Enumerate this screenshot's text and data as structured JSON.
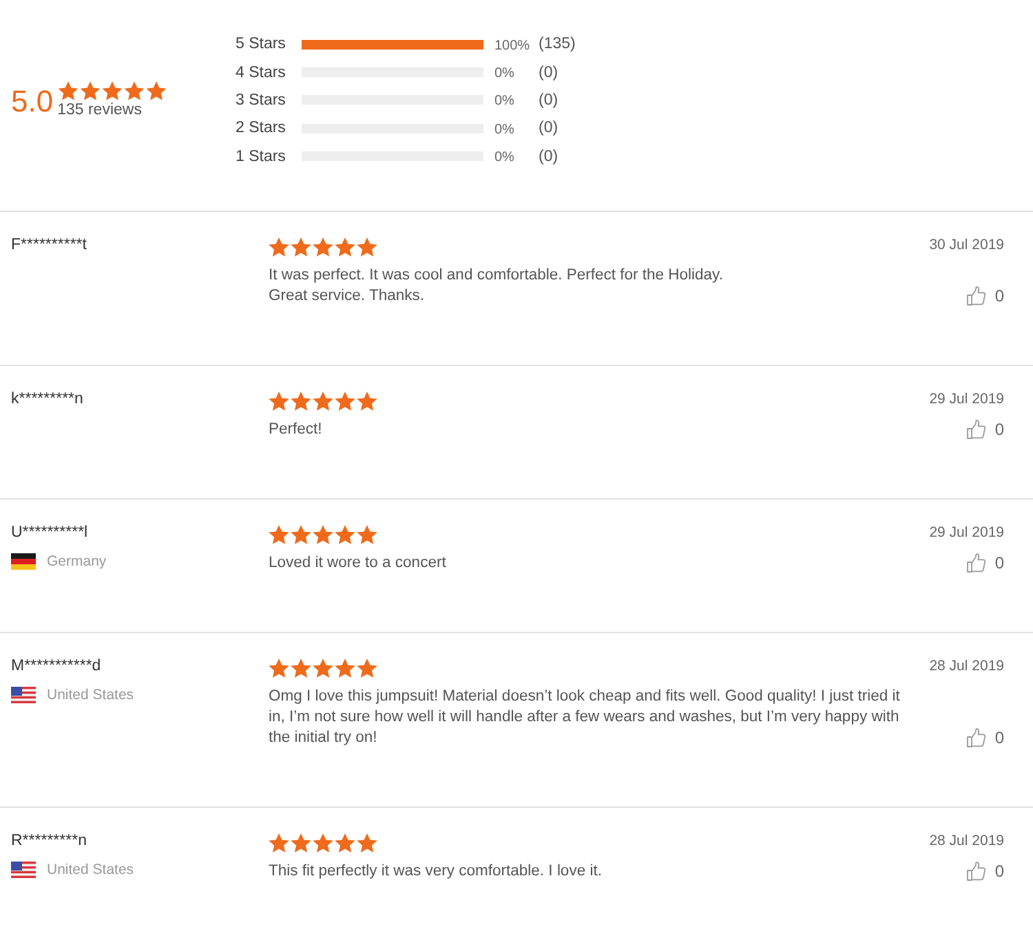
{
  "summary": {
    "average": "5.0",
    "stars": 5,
    "review_count": "135 reviews",
    "histogram": [
      {
        "label": "5 Stars",
        "level": 1,
        "percent": "100%",
        "count": "(135)"
      },
      {
        "label": "4 Stars",
        "level": 0,
        "percent": "0%",
        "count": "(0)"
      },
      {
        "label": "3 Stars",
        "level": 0,
        "percent": "0%",
        "count": "(0)"
      },
      {
        "label": "2 Stars",
        "level": 0,
        "percent": "0%",
        "count": "(0)"
      },
      {
        "label": "1 Stars",
        "level": 0,
        "percent": "0%",
        "count": "(0)"
      }
    ]
  },
  "reviews": [
    {
      "name": "F**********t",
      "stars": 5,
      "text": "It was perfect. It was cool and comfortable. Perfect for the Holiday.\nGreat service. Thanks.",
      "date": "30 Jul 2019",
      "likes": "0"
    },
    {
      "name": "k*********n",
      "stars": 5,
      "text": "Perfect!",
      "date": "29 Jul 2019",
      "likes": "0"
    },
    {
      "name": "U**********l",
      "country": {
        "kind": "de",
        "name": "Germany"
      },
      "stars": 5,
      "text": "Loved it wore to a concert",
      "date": "29 Jul 2019",
      "likes": "0"
    },
    {
      "name": "M***********d",
      "country": {
        "kind": "us",
        "name": "United States"
      },
      "stars": 5,
      "text": "Omg I love this jumpsuit! Material doesn’t look cheap and fits well. Good quality!  I just tried it in, I’m not sure how well it will handle after a few wears and washes, but I’m very happy with the initial try on!",
      "date": "28 Jul 2019",
      "likes": "0"
    },
    {
      "name": "R*********n",
      "country": {
        "kind": "us",
        "name": "United States"
      },
      "stars": 5,
      "text": "This fit perfectly it was very comfortable. I love it.",
      "date": "28 Jul 2019",
      "likes": "0"
    }
  ]
}
